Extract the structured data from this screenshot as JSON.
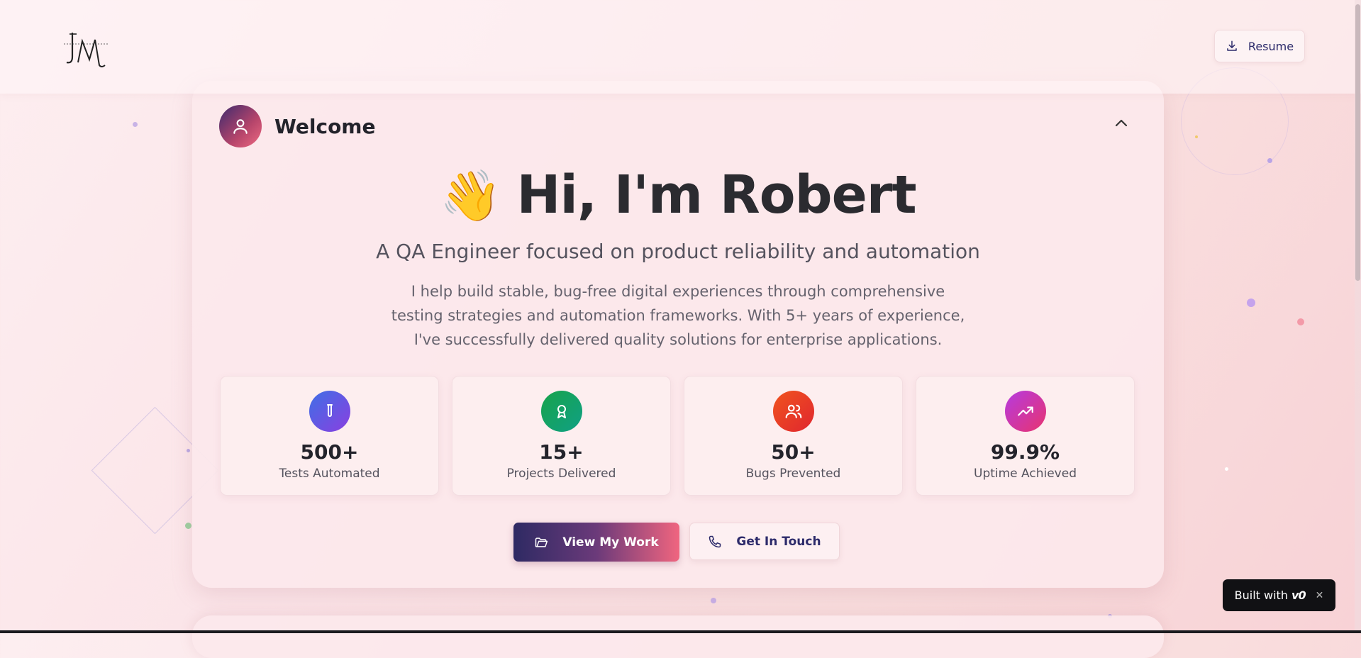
{
  "header": {
    "logo_text": "JM",
    "resume_label": "Resume",
    "resume_icon": "download-icon"
  },
  "welcome": {
    "title": "Welcome",
    "avatar_icon": "user-icon",
    "collapse_icon": "chevron-up-icon"
  },
  "hero": {
    "wave_emoji": "👋",
    "heading": "Hi, I'm Robert",
    "subtitle": "A QA Engineer focused on product reliability and automation",
    "description": "I help build stable, bug-free digital experiences through comprehensive testing strategies and automation frameworks. With 5+ years of experience, I've successfully delivered quality solutions for enterprise applications."
  },
  "stats": [
    {
      "value": "500+",
      "label": "Tests Automated",
      "icon": "test-tube-icon",
      "color_from": "#3f6fe6",
      "color_to": "#8a3fe0"
    },
    {
      "value": "15+",
      "label": "Projects Delivered",
      "icon": "award-icon",
      "color_from": "#17a34a",
      "color_to": "#10a085"
    },
    {
      "value": "50+",
      "label": "Bugs Prevented",
      "icon": "users-icon",
      "color_from": "#f0541e",
      "color_to": "#e0262f"
    },
    {
      "value": "99.9%",
      "label": "Uptime Achieved",
      "icon": "trending-up-icon",
      "color_from": "#b53be0",
      "color_to": "#e8336f"
    }
  ],
  "actions": {
    "work_label": "View My Work",
    "work_icon": "folder-open-icon",
    "touch_label": "Get In Touch",
    "touch_icon": "phone-icon"
  },
  "badge": {
    "label": "Built with",
    "logo": "v0",
    "close": "✕"
  }
}
